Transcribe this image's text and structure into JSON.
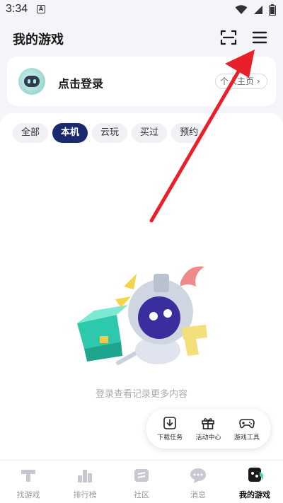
{
  "status_bar": {
    "time": "3:34",
    "notification_letter": "A"
  },
  "header": {
    "title": "我的游戏",
    "scan_icon": "scan-icon",
    "menu_icon": "menu-icon"
  },
  "login": {
    "text": "点击登录",
    "home_button": "个人主页 ›"
  },
  "tabs": [
    {
      "label": "全部",
      "active": false
    },
    {
      "label": "本机",
      "active": true
    },
    {
      "label": "云玩",
      "active": false
    },
    {
      "label": "买过",
      "active": false
    },
    {
      "label": "预约",
      "active": false
    }
  ],
  "empty_state": {
    "text": "登录查看记录更多内容"
  },
  "floating_toolbar": [
    {
      "label": "下载任务",
      "icon": "download-icon"
    },
    {
      "label": "活动中心",
      "icon": "gift-icon"
    },
    {
      "label": "游戏工具",
      "icon": "gamepad-icon"
    }
  ],
  "bottom_nav": [
    {
      "label": "找游戏",
      "icon": "find-games-icon",
      "active": false
    },
    {
      "label": "排行榜",
      "icon": "ranking-icon",
      "active": false
    },
    {
      "label": "社区",
      "icon": "community-icon",
      "active": false
    },
    {
      "label": "消息",
      "icon": "message-icon",
      "active": false
    },
    {
      "label": "我的游戏",
      "icon": "my-games-icon",
      "active": true
    }
  ],
  "colors": {
    "accent": "#1a2a6c",
    "arrow": "#e8202a",
    "mint": "#3fd1b5"
  }
}
